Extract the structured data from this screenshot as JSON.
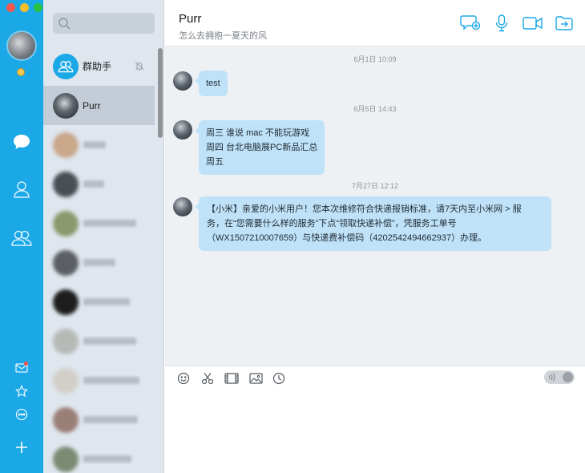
{
  "window": {
    "title": "Purr"
  },
  "rail": {
    "items": [
      {
        "name": "messages",
        "icon": "chat-bubble-icon"
      },
      {
        "name": "contacts",
        "icon": "person-icon"
      },
      {
        "name": "groups",
        "icon": "group-icon"
      }
    ],
    "bottom": [
      {
        "name": "mail",
        "icon": "mail-icon",
        "badge": true
      },
      {
        "name": "favorites",
        "icon": "star-icon"
      },
      {
        "name": "more",
        "icon": "more-icon"
      },
      {
        "name": "add",
        "icon": "plus-icon"
      }
    ]
  },
  "search": {
    "placeholder": ""
  },
  "contacts": [
    {
      "name": "群助手",
      "muted": true
    },
    {
      "name": "Purr",
      "selected": true
    },
    {
      "name": ""
    },
    {
      "name": ""
    },
    {
      "name": ""
    },
    {
      "name": ""
    },
    {
      "name": ""
    },
    {
      "name": ""
    },
    {
      "name": ""
    },
    {
      "name": ""
    },
    {
      "name": ""
    }
  ],
  "chat": {
    "title": "Purr",
    "subtitle": "怎么去拥抱一夏天的风",
    "header_actions": [
      "new-chat-icon",
      "microphone-icon",
      "video-icon",
      "share-icon"
    ],
    "messages": [
      {
        "timestamp": "6月1日  10:09",
        "lines": [
          "test"
        ]
      },
      {
        "timestamp": "6月5日  14:43",
        "lines": [
          "周三 谁说 mac 不能玩游戏",
          "周四 台北电脑展PC新品汇总",
          "周五"
        ]
      },
      {
        "timestamp": "7月27日  12:12",
        "lines": [
          "【小米】亲爱的小米用户！您本次维修符合快递报销标准，请7天内至小米网 > 服",
          "务，在“您需要什么样的服务”下点“领取快递补偿”，凭服务工单号",
          "（WX1507210007659）与快递费补偿码（4202542494662937）办理。"
        ]
      }
    ]
  },
  "composer": {
    "tools": [
      "emoji-icon",
      "scissors-icon",
      "film-icon",
      "image-icon",
      "clock-icon"
    ],
    "input_value": ""
  },
  "colors": {
    "rail": "#1aa8e6",
    "bubble": "#bfe2f8",
    "list_bg": "#dfe6ee",
    "selected_row": "#c4cdd7",
    "accent": "#1aa8e6"
  }
}
